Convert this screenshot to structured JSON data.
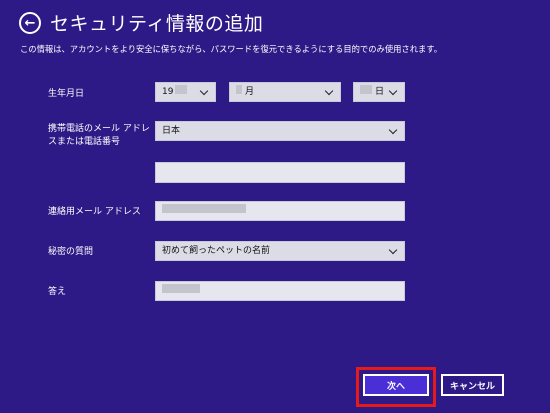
{
  "header": {
    "back_icon": "back-arrow-icon",
    "back_glyph": "←",
    "title": "セキュリティ情報の追加"
  },
  "description": "この情報は、アカウントをより安全に保ちながら、パスワードを復元できるようにする目的でのみ使用されます。",
  "form": {
    "birthdate": {
      "label": "生年月日",
      "year_value": "19",
      "month_value": "月",
      "day_value": "日"
    },
    "phone": {
      "label_line1": "携帯電話のメール アドレ",
      "label_line2": "スまたは電話番号",
      "country_value": "日本",
      "number_value": ""
    },
    "contact_email": {
      "label": "連絡用メール アドレス",
      "value": ""
    },
    "secret_question": {
      "label": "秘密の質問",
      "value": "初めて飼ったペットの名前"
    },
    "answer": {
      "label": "答え",
      "value": ""
    }
  },
  "buttons": {
    "next_label": "次へ",
    "cancel_label": "キャンセル"
  },
  "colors": {
    "background": "#2e1a87",
    "field": "#dcdce6",
    "primary_button": "#4b2fd6",
    "highlight": "#e81919"
  }
}
